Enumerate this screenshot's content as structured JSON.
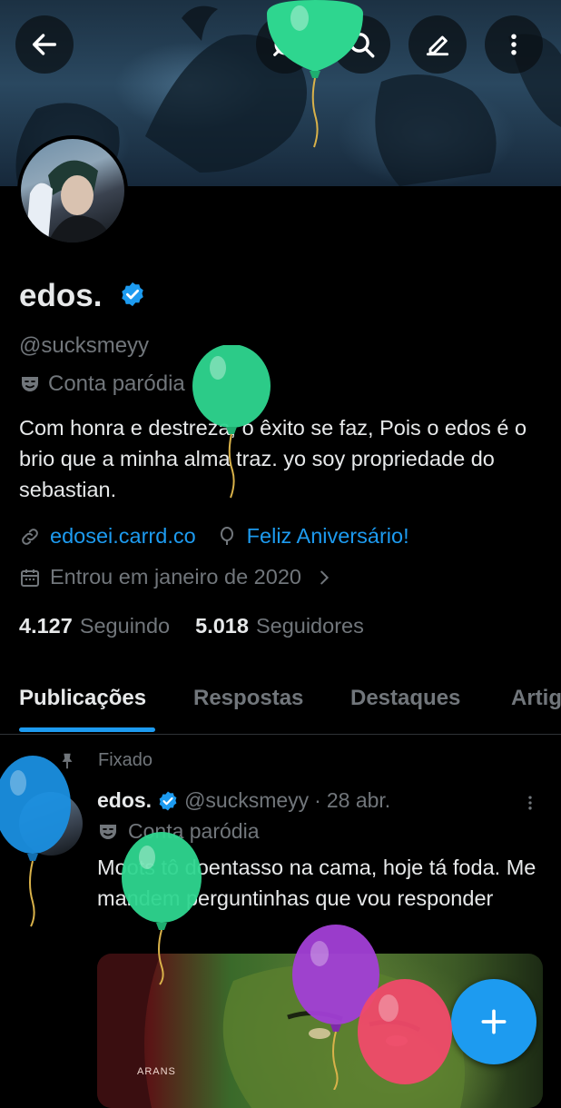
{
  "profile": {
    "name": "edos.",
    "handle": "@sucksmeyy",
    "parody_label": "Conta paródia",
    "bio": "Com honra e destreza, o êxito se faz, Pois o edos é o brio que a minha alma traz. yo soy propriedade do sebastian.",
    "website": "edosei.carrd.co",
    "birthday": "Feliz Aniversário!",
    "joined": "Entrou em janeiro de 2020",
    "following_count": "4.127",
    "following_label": "Seguindo",
    "followers_count": "5.018",
    "followers_label": "Seguidores"
  },
  "tabs": [
    {
      "label": "Publicações",
      "active": true
    },
    {
      "label": "Respostas",
      "active": false
    },
    {
      "label": "Destaques",
      "active": false
    },
    {
      "label": "Artig",
      "active": false
    }
  ],
  "post": {
    "pinned_label": "Fixado",
    "author_name": "edos.",
    "author_handle": "@sucksmeyy",
    "separator": "·",
    "date": "28 abr.",
    "parody_label": "Conta paródia",
    "text": "Moots tô doentasso na cama, hoje tá foda. Me mandem perguntinhas que vou responder",
    "media_caption": "ARANS"
  },
  "icons": {
    "back": "back-arrow-icon",
    "grok": "grok-icon",
    "search": "search-icon",
    "edit": "edit-icon",
    "more": "more-vertical-icon",
    "verified": "verified-badge-icon",
    "parody": "theater-mask-icon",
    "link": "link-icon",
    "birthday": "balloon-icon",
    "calendar": "calendar-icon",
    "pin": "pin-icon",
    "compose": "plus-icon"
  },
  "colors": {
    "accent": "#1d9bf0",
    "background": "#000000",
    "text_primary": "#e7e9ea",
    "text_secondary": "#71767b",
    "balloon_green": "#2ed68f",
    "balloon_blue": "#1a8fe0",
    "balloon_purple": "#a23fd6",
    "balloon_red": "#f04a6a"
  }
}
